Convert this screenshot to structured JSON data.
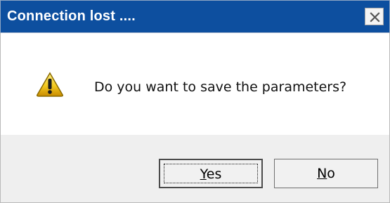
{
  "window": {
    "title": "Connection lost ....",
    "close_icon": "close-icon"
  },
  "dialog": {
    "icon": "warning-icon",
    "message": "Do you want to save the parameters?"
  },
  "buttons": {
    "yes": {
      "mnemonic": "Y",
      "rest": "es"
    },
    "no": {
      "mnemonic": "N",
      "rest": "o"
    }
  },
  "colors": {
    "titlebar": "#0d4f9f",
    "content_background": "#ffffff",
    "footer_background": "#efefef",
    "warning_fill": "#f2c21b"
  }
}
